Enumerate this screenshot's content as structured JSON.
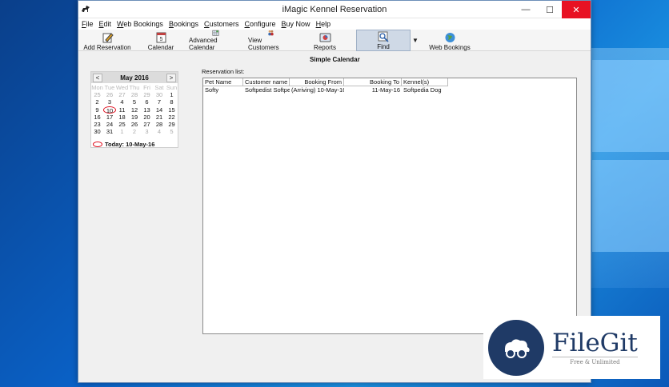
{
  "window": {
    "title": "iMagic Kennel Reservation"
  },
  "menu": [
    {
      "u": "F",
      "rest": "ile"
    },
    {
      "u": "E",
      "rest": "dit"
    },
    {
      "u": "W",
      "rest": "eb Bookings"
    },
    {
      "u": "B",
      "rest": "ookings"
    },
    {
      "u": "C",
      "rest": "ustomers"
    },
    {
      "u": "C",
      "rest": "onfigure"
    },
    {
      "u": "B",
      "rest": "uy Now"
    },
    {
      "u": "H",
      "rest": "elp"
    }
  ],
  "toolbar": {
    "add_reservation": "Add Reservation",
    "calendar": "Calendar",
    "advanced_calendar": "Advanced Calendar",
    "view_customers": "View Customers",
    "reports": "Reports",
    "find": "Find",
    "web_bookings": "Web Bookings"
  },
  "view_title": "Simple Calendar",
  "calendar": {
    "prev": "<",
    "next": ">",
    "month_label": "May 2016",
    "day_names": [
      "Mon",
      "Tue",
      "Wed",
      "Thu",
      "Fri",
      "Sat",
      "Sun"
    ],
    "weeks": [
      [
        "25",
        "26",
        "27",
        "28",
        "29",
        "30",
        "1"
      ],
      [
        "2",
        "3",
        "4",
        "5",
        "6",
        "7",
        "8"
      ],
      [
        "9",
        "10",
        "11",
        "12",
        "13",
        "14",
        "15"
      ],
      [
        "16",
        "17",
        "18",
        "19",
        "20",
        "21",
        "22"
      ],
      [
        "23",
        "24",
        "25",
        "26",
        "27",
        "28",
        "29"
      ],
      [
        "30",
        "31",
        "1",
        "2",
        "3",
        "4",
        "5"
      ]
    ],
    "muted_first_row_count": 6,
    "muted_last_row_from": 2,
    "today_value": "10",
    "today_label": "Today: 10-May-16"
  },
  "reservations": {
    "label": "Reservation list:",
    "columns": [
      "Pet Name",
      "Customer name",
      "Booking From",
      "Booking To",
      "Kennel(s)"
    ],
    "rows": [
      [
        "Softy",
        "Softpedist Softpedi",
        "(Arriving) 10-May-16",
        "11-May-16",
        "Softpedia Dog"
      ]
    ]
  },
  "watermark": {
    "brand": "FileGit",
    "tagline": "Free & Unlimited"
  },
  "colors": {
    "accent_close": "#e81123",
    "today_ring": "#e01020",
    "brand_navy": "#1f3a66"
  }
}
